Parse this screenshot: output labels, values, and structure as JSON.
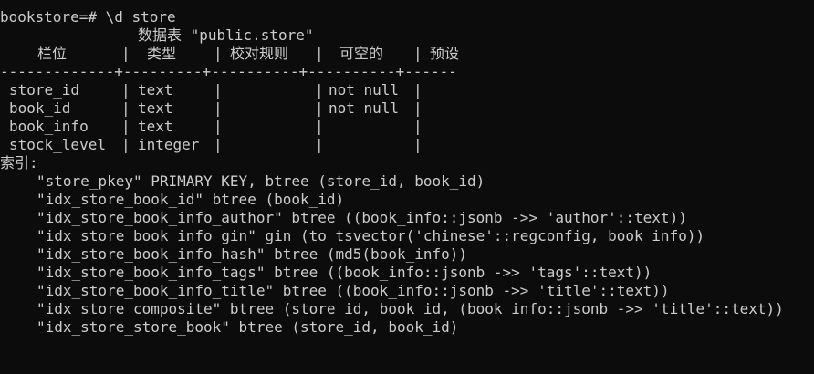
{
  "colors": {
    "background": "#0c0c0c",
    "foreground": "#cccccc"
  },
  "prompt_line": "bookstore=# \\d store",
  "table_title": "数据表 \"public.store\"",
  "headers": [
    "栏位",
    "类型",
    "校对规则",
    "可空的",
    "预设"
  ],
  "separator_line": "-------------+---------+----------+----------+------",
  "rows": [
    {
      "column": "store_id",
      "type": "text",
      "collation": "",
      "nullable": "not null",
      "default": ""
    },
    {
      "column": "book_id",
      "type": "text",
      "collation": "",
      "nullable": "not null",
      "default": ""
    },
    {
      "column": "book_info",
      "type": "text",
      "collation": "",
      "nullable": "",
      "default": ""
    },
    {
      "column": "stock_level",
      "type": "integer",
      "collation": "",
      "nullable": "",
      "default": ""
    }
  ],
  "indexes_label": "索引:",
  "indexes": [
    "\"store_pkey\" PRIMARY KEY, btree (store_id, book_id)",
    "\"idx_store_book_id\" btree (book_id)",
    "\"idx_store_book_info_author\" btree ((book_info::jsonb ->> 'author'::text))",
    "\"idx_store_book_info_gin\" gin (to_tsvector('chinese'::regconfig, book_info))",
    "\"idx_store_book_info_hash\" btree (md5(book_info))",
    "\"idx_store_book_info_tags\" btree ((book_info::jsonb ->> 'tags'::text))",
    "\"idx_store_book_info_title\" btree ((book_info::jsonb ->> 'title'::text))",
    "\"idx_store_composite\" btree (store_id, book_id, (book_info::jsonb ->> 'title'::text))",
    "\"idx_store_store_book\" btree (store_id, book_id)"
  ]
}
